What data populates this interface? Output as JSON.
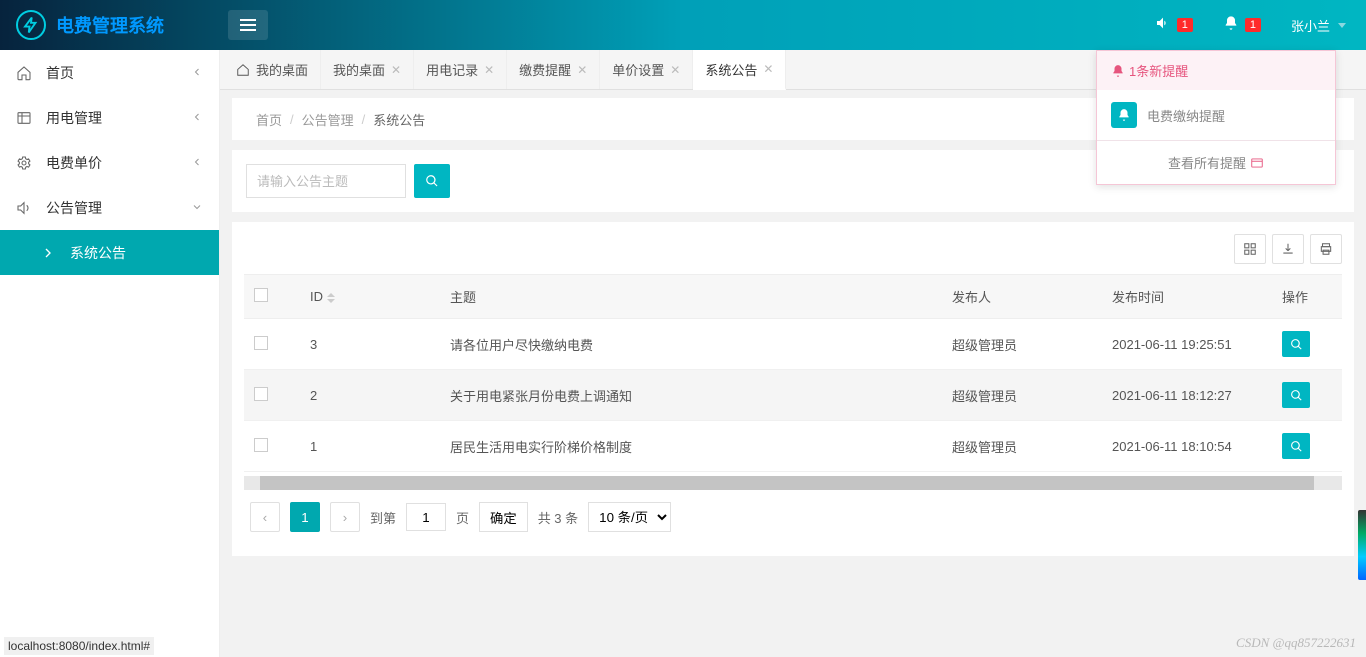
{
  "header": {
    "app_title": "电费管理系统",
    "notif_sound_count": "1",
    "notif_bell_count": "1",
    "username": "张小兰"
  },
  "sidebar": {
    "items": [
      {
        "label": "首页",
        "icon": "home"
      },
      {
        "label": "用电管理",
        "icon": "grid"
      },
      {
        "label": "电费单价",
        "icon": "gear"
      },
      {
        "label": "公告管理",
        "icon": "speaker",
        "open": true
      }
    ],
    "sub_active": "系统公告"
  },
  "tabs": [
    {
      "label": "我的桌面",
      "home": true
    },
    {
      "label": "我的桌面",
      "closable": true
    },
    {
      "label": "用电记录",
      "closable": true
    },
    {
      "label": "缴费提醒",
      "closable": true
    },
    {
      "label": "单价设置",
      "closable": true
    },
    {
      "label": "系统公告",
      "closable": true,
      "active": true
    }
  ],
  "breadcrumb": {
    "a": "首页",
    "b": "公告管理",
    "c": "系统公告"
  },
  "search": {
    "placeholder": "请输入公告主题"
  },
  "table": {
    "columns": {
      "id": "ID",
      "subject": "主题",
      "publisher": "发布人",
      "time": "发布时间",
      "op": "操作"
    },
    "rows": [
      {
        "id": "3",
        "subject": "请各位用户尽快缴纳电费",
        "publisher": "超级管理员",
        "time": "2021-06-11 19:25:51"
      },
      {
        "id": "2",
        "subject": "关于用电紧张月份电费上调通知",
        "publisher": "超级管理员",
        "time": "2021-06-11 18:12:27"
      },
      {
        "id": "1",
        "subject": "居民生活用电实行阶梯价格制度",
        "publisher": "超级管理员",
        "time": "2021-06-11 18:10:54"
      }
    ]
  },
  "pager": {
    "current": "1",
    "goto_label": "到第",
    "goto_value": "1",
    "page_label": "页",
    "confirm": "确定",
    "total": "共 3 条",
    "per_page": "10 条/页"
  },
  "popover": {
    "title": "1条新提醒",
    "item": "电费缴纳提醒",
    "footer": "查看所有提醒"
  },
  "statusbar": "localhost:8080/index.html#",
  "watermark": "CSDN @qq857222631"
}
